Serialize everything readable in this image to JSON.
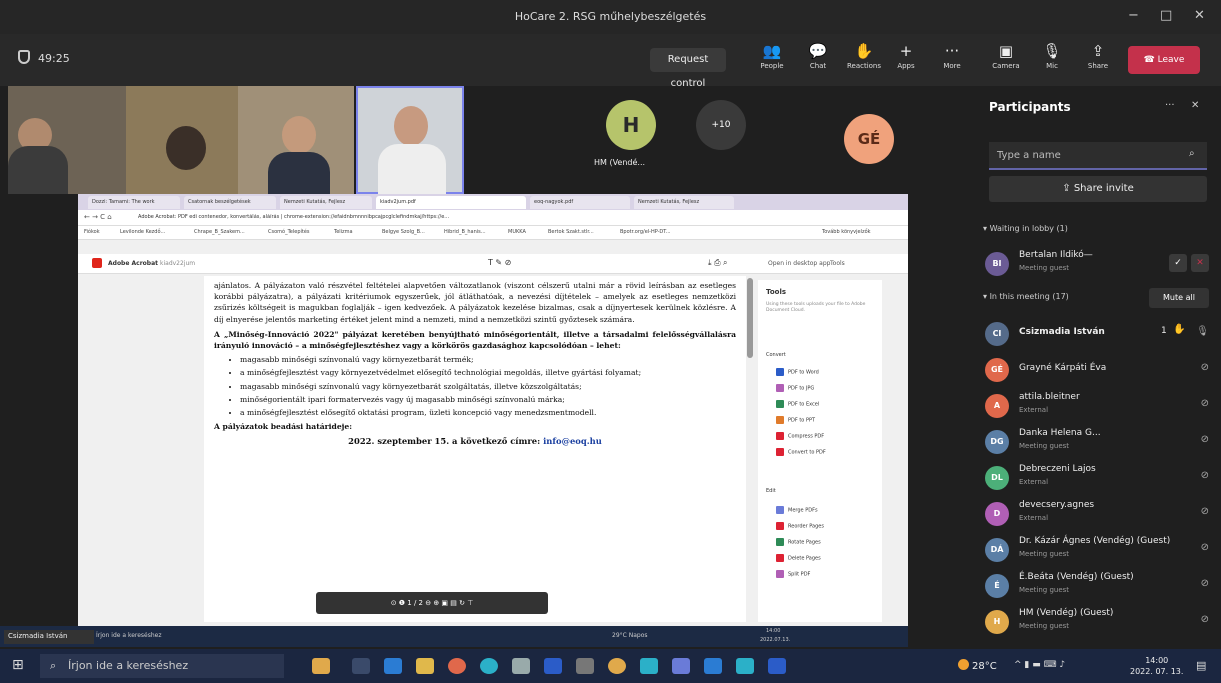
{
  "window": {
    "title": "HoCare 2. RSG műhelybeszélgetés",
    "minimize": "−",
    "maximize": "□",
    "close": "✕"
  },
  "toolbar": {
    "timer": "49:25",
    "request_control": "Request control",
    "items": [
      {
        "label": "People",
        "icon": "people-icon"
      },
      {
        "label": "Chat",
        "icon": "chat-icon"
      },
      {
        "label": "Reactions",
        "icon": "reactions-icon"
      },
      {
        "label": "Apps",
        "icon": "apps-icon"
      },
      {
        "label": "More",
        "icon": "more-icon"
      },
      {
        "label": "Camera",
        "icon": "camera-icon"
      },
      {
        "label": "Mic",
        "icon": "mic-icon"
      },
      {
        "label": "Share",
        "icon": "share-icon"
      }
    ],
    "leave": "Leave"
  },
  "strip": {
    "tile_h_initial": "H",
    "tile_h_name": "HM (Vendé...",
    "more_count": "+10",
    "tile_ge_initial": "GÉ"
  },
  "participants": {
    "title": "Participants",
    "search_placeholder": "Type a name",
    "share_invite": "Share invite",
    "waiting_header": "Waiting in lobby (1)",
    "waiting": [
      {
        "initials": "BI",
        "name": "Bertalan Ildikó—",
        "sub": "Meeting guest",
        "color": "#6b5b95"
      }
    ],
    "in_meeting_header": "In this meeting (17)",
    "mute_all": "Mute all",
    "people": [
      {
        "initials": "CI",
        "name": "Csizmadia István",
        "sub": "",
        "color": "#556b8a",
        "badge": "1"
      },
      {
        "initials": "GÉ",
        "name": "Grayné Kárpáti Éva",
        "sub": "",
        "color": "#e0684b"
      },
      {
        "initials": "A",
        "name": "attila.bleitner",
        "sub": "External",
        "color": "#e0684b"
      },
      {
        "initials": "DG",
        "name": "Danka Helena G...",
        "sub": "Meeting guest",
        "color": "#5b7fa6"
      },
      {
        "initials": "DL",
        "name": "Debreczeni Lajos",
        "sub": "External",
        "color": "#4caf79"
      },
      {
        "initials": "D",
        "name": "devecsery.agnes",
        "sub": "External",
        "color": "#b05fb5"
      },
      {
        "initials": "DÁ",
        "name": "Dr. Kázár Ágnes (Vendég) (Guest)",
        "sub": "Meeting guest",
        "color": "#5b7fa6"
      },
      {
        "initials": "É",
        "name": "É.Beáta (Vendég) (Guest)",
        "sub": "Meeting guest",
        "color": "#5b7fa6"
      },
      {
        "initials": "H",
        "name": "HM (Vendég) (Guest)",
        "sub": "Meeting guest",
        "color": "#e0a94b"
      }
    ]
  },
  "browser": {
    "tabs": [
      "Dozzi: Tamami: The work",
      "Csatornak beszélgetések",
      "Nemzeti Kutatás, Fejlesz",
      "kiadv2jum.pdf",
      "eoq-nagyok.pdf",
      "Nemzeti Kutatás, Fejlesz"
    ],
    "address": "Adobe Acrobat: PDF edi contenedor, konvertálás, aláírás | chrome-extension://efaidnbmnnnibpcajpcglclefindmkaj/https://e...",
    "bookmarks": [
      "Fiókok",
      "Levilonde Kezdő...",
      "Chrape_B_Szakem...",
      "Csomó_Telepítés",
      "Telizma",
      "Belgye Szolg_B...",
      "Hibrid_B_hanis...",
      "MUKKA",
      "Bertok Szakt.stlr...",
      "Bpotr.org/el-HP-DT...",
      "Tovább könyvjelzők"
    ],
    "acrobat_title": "Adobe Acrobat",
    "acrobat_file": "kiadv22jum",
    "open_desktop": "Open in desktop app",
    "tools_btn": "Tools"
  },
  "document": {
    "para1": "ajánlatos. A pályázaton való részvétel feltételei alapvetően változatlanok (viszont célszerű utalni már a rövid leírásban az esetleges korábbi pályázatra), a pályázati kritériumok egyszerűek, jól átláthatóak, a nevezési díjtételek – amelyek az esetleges nemzetközi zsűrizés költségeit is magukban foglalják – igen kedvezőek. A pályázatok kezelése bizalmas, csak a díjnyertesek kerülnek közlésre. A díj elnyerése jelentős marketing értéket jelent mind a nemzeti, mind a nemzetközi szintű győztesek számára.",
    "para2": "A „Minőség-Innováció 2022\" pályázat keretében benyújtható minőségorientált, illetve a társadalmi felelősségvállalásra irányuló innováció – a minőségfejlesztéshez vagy a körkörös gazdasághoz kapcsolódóan – lehet:",
    "bullets": [
      "magasabb minőségi színvonalú vagy környezetbarát termék;",
      "a minőségfejlesztést vagy környezetvédelmet elősegítő technológiai megoldás, illetve gyártási folyamat;",
      "magasabb minőségi színvonalú vagy környezetbarát szolgáltatás, illetve közszolgáltatás;",
      "minőségorientált ipari formatervezés vagy új magasabb minőségi színvonalú márka;",
      "a minőségfejlesztést elősegítő oktatási program, üzleti koncepció vagy menedzsmentmodell."
    ],
    "deadline_title": "A pályázatok beadási határideje:",
    "deadline": "2022. szeptember 15. a következő címre: ",
    "email": "info@eoq.hu",
    "page_ctrl": "1 / 2"
  },
  "tools_panel": {
    "title": "Tools",
    "desc": "Using these tools uploads your file to Adobe Document Cloud.",
    "convert_header": "Convert",
    "convert": [
      "PDF to Word",
      "PDF to JPG",
      "PDF to Excel",
      "PDF to PPT",
      "Compress PDF",
      "Convert to PDF"
    ],
    "edit_header": "Edit",
    "edit": [
      "Merge PDFs",
      "Reorder Pages",
      "Rotate Pages",
      "Delete Pages",
      "Split PDF"
    ]
  },
  "inner_taskbar": {
    "search": "Írjon ide a kereséshez",
    "weather": "29°C Napos",
    "time": "14:00",
    "date": "2022.07.13."
  },
  "presenter_name": "Csizmadia István",
  "taskbar": {
    "search": "Írjon ide a kereséshez",
    "weather": "28°C",
    "time": "14:00",
    "date": "2022. 07. 13."
  }
}
